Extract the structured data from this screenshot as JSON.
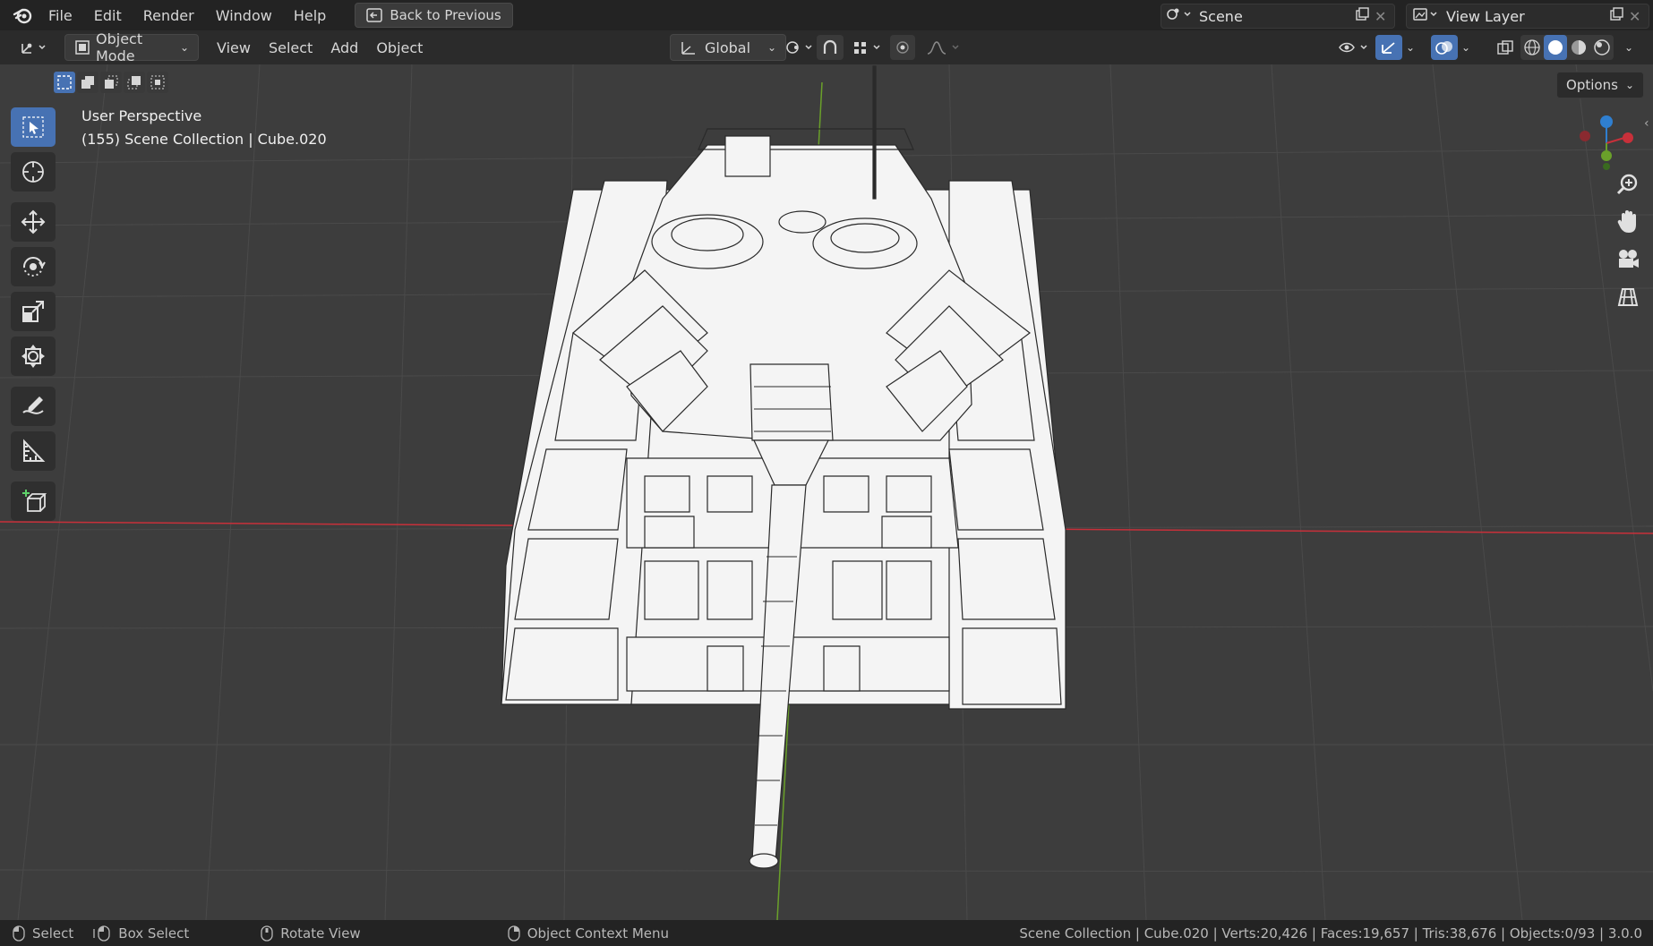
{
  "menu": {
    "items": [
      "File",
      "Edit",
      "Render",
      "Window",
      "Help"
    ],
    "back_label": "Back to Previous"
  },
  "scene": {
    "name": "Scene",
    "view_layer": "View Layer"
  },
  "header": {
    "mode": "Object Mode",
    "menus": [
      "View",
      "Select",
      "Add",
      "Object"
    ],
    "orientation": "Global",
    "options_label": "Options"
  },
  "viewport": {
    "perspective": "User Perspective",
    "collection": "(155) Scene Collection | Cube.020"
  },
  "statusbar": {
    "select": "Select",
    "box_select": "Box Select",
    "rotate": "Rotate View",
    "context": "Object Context Menu",
    "stats": "Scene Collection | Cube.020 | Verts:20,426 | Faces:19,657 | Tris:38,676 | Objects:0/93 | 3.0.0"
  },
  "colors": {
    "accent": "#4772b3",
    "x_axis": "#c8303a",
    "y_axis": "#6aa02a",
    "z_axis": "#2f7fd0"
  },
  "icons": [
    "blender-logo",
    "back-icon",
    "scene-icon",
    "view-layer-icon",
    "object-mode-icon",
    "global-icon",
    "snap-icon",
    "proportional-icon",
    "gizmo-icon",
    "overlay-icon",
    "xray-icon",
    "wireframe-shading-icon",
    "solid-shading-icon",
    "material-shading-icon",
    "rendered-shading-icon",
    "select-tool-icon",
    "cursor-tool-icon",
    "move-tool-icon",
    "rotate-tool-icon",
    "scale-tool-icon",
    "transform-tool-icon",
    "annotate-tool-icon",
    "measure-tool-icon",
    "add-cube-tool-icon",
    "zoom-icon",
    "pan-hand-icon",
    "camera-icon",
    "grid-view-icon",
    "mouse-left-icon",
    "mouse-middle-icon",
    "mouse-right-icon"
  ]
}
